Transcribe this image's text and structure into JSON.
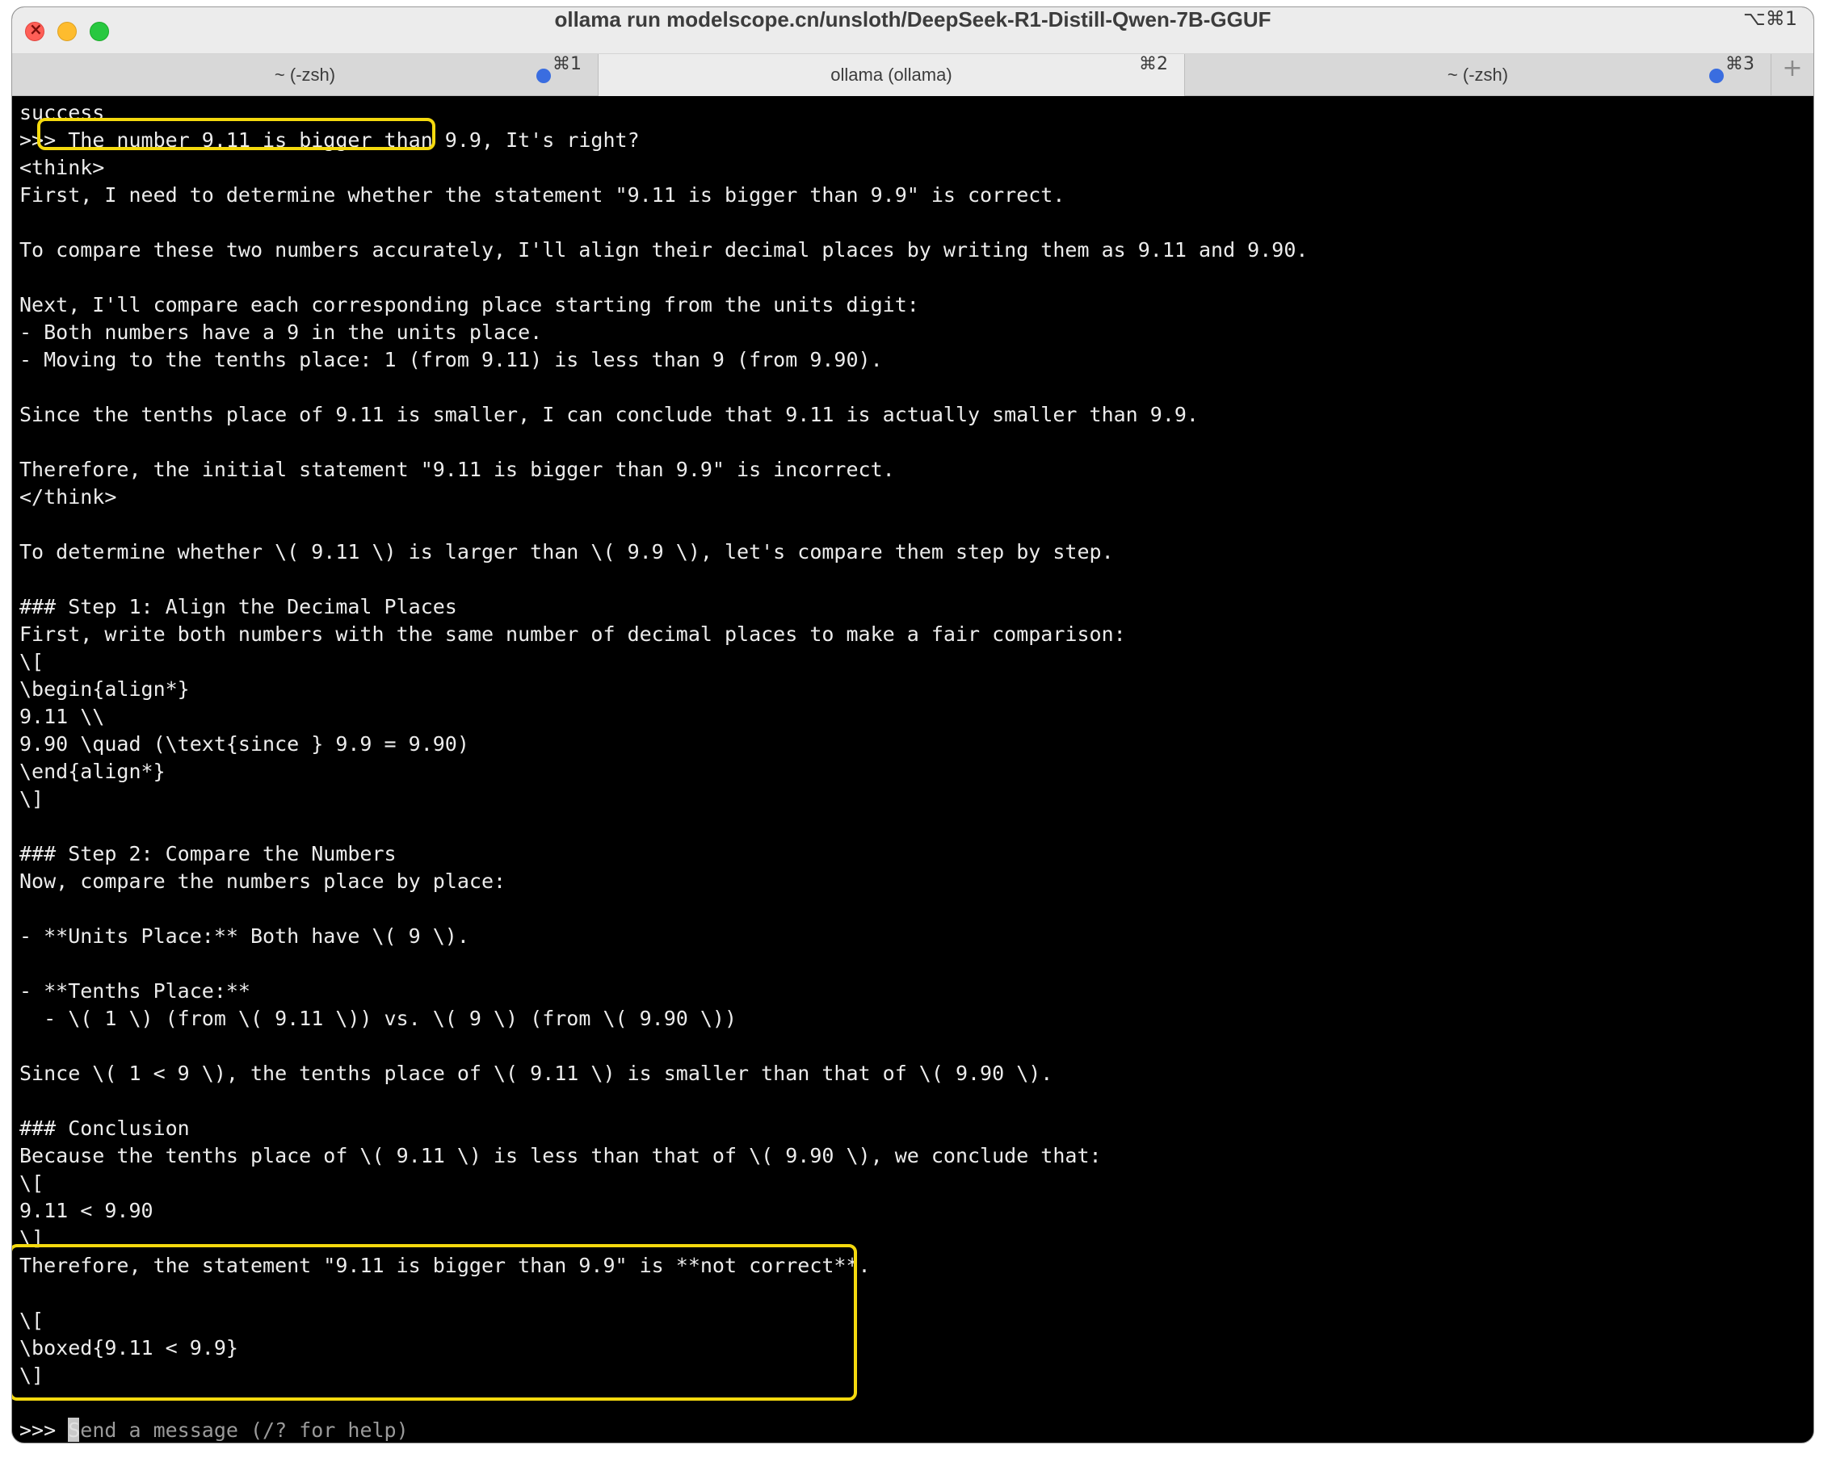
{
  "window": {
    "title": "ollama run modelscope.cn/unsloth/DeepSeek-R1-Distill-Qwen-7B-GGUF",
    "shortcut": "⌥⌘1"
  },
  "tabs": [
    {
      "label": "~ (-zsh)",
      "shortcut": "⌘1",
      "has_activity_dot": true,
      "active": false
    },
    {
      "label": "ollama (ollama)",
      "shortcut": "⌘2",
      "has_activity_dot": false,
      "active": true
    },
    {
      "label": "~ (-zsh)",
      "shortcut": "⌘3",
      "has_activity_dot": true,
      "active": false
    }
  ],
  "new_tab_label": "+",
  "terminal": {
    "success_line": "success",
    "prompt_symbol": ">>>",
    "user_question": "The number 9.11 is bigger than 9.9, It's right?",
    "response_lines": [
      "<think>",
      "First, I need to determine whether the statement \"9.11 is bigger than 9.9\" is correct.",
      "",
      "To compare these two numbers accurately, I'll align their decimal places by writing them as 9.11 and 9.90.",
      "",
      "Next, I'll compare each corresponding place starting from the units digit:",
      "- Both numbers have a 9 in the units place.",
      "- Moving to the tenths place: 1 (from 9.11) is less than 9 (from 9.90).",
      "",
      "Since the tenths place of 9.11 is smaller, I can conclude that 9.11 is actually smaller than 9.9.",
      "",
      "Therefore, the initial statement \"9.11 is bigger than 9.9\" is incorrect.",
      "</think>",
      "",
      "To determine whether \\( 9.11 \\) is larger than \\( 9.9 \\), let's compare them step by step.",
      "",
      "### Step 1: Align the Decimal Places",
      "First, write both numbers with the same number of decimal places to make a fair comparison:",
      "\\[",
      "\\begin{align*}",
      "9.11 \\\\",
      "9.90 \\quad (\\text{since } 9.9 = 9.90)",
      "\\end{align*}",
      "\\]",
      "",
      "### Step 2: Compare the Numbers",
      "Now, compare the numbers place by place:",
      "",
      "- **Units Place:** Both have \\( 9 \\).",
      "",
      "- **Tenths Place:**",
      "  - \\( 1 \\) (from \\( 9.11 \\)) vs. \\( 9 \\) (from \\( 9.90 \\))",
      "",
      "Since \\( 1 < 9 \\), the tenths place of \\( 9.11 \\) is smaller than that of \\( 9.90 \\).",
      "",
      "### Conclusion",
      "Because the tenths place of \\( 9.11 \\) is less than that of \\( 9.90 \\), we conclude that:",
      "\\[",
      "9.11 < 9.90",
      "\\]",
      "Therefore, the statement \"9.11 is bigger than 9.9\" is **not correct**.",
      "",
      "\\[",
      "\\boxed{9.11 < 9.9}",
      "\\]",
      ""
    ],
    "input_prompt": ">>>",
    "input_placeholder": "Send a message (/? for help)"
  },
  "highlight_color": "#f4d90e"
}
